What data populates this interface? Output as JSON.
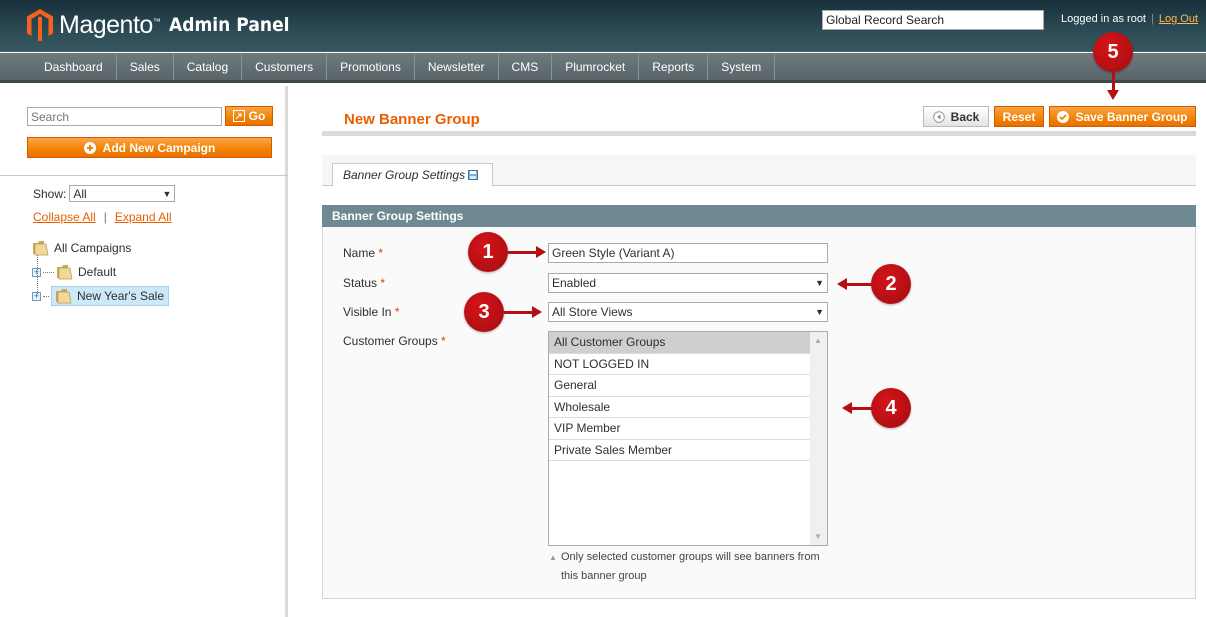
{
  "header": {
    "logo_text": "Magento",
    "logo_tm": "™",
    "logo_sub": "Admin Panel",
    "global_search_value": "Global Record Search",
    "logged_in_text": "Logged in as root",
    "logout_label": "Log Out"
  },
  "nav": {
    "items": [
      "Dashboard",
      "Sales",
      "Catalog",
      "Customers",
      "Promotions",
      "Newsletter",
      "CMS",
      "Plumrocket",
      "Reports",
      "System"
    ]
  },
  "sidebar": {
    "search_placeholder": "Search",
    "go_label": "Go",
    "add_campaign_label": "Add New Campaign",
    "show_label": "Show:",
    "show_value": "All",
    "collapse_all": "Collapse All",
    "expand_all": "Expand All",
    "separator": "|",
    "tree": {
      "root": "All Campaigns",
      "children": [
        "Default",
        "New Year's Sale"
      ],
      "selected": "New Year's Sale"
    }
  },
  "main": {
    "title": "New Banner Group",
    "buttons": {
      "back": "Back",
      "reset": "Reset",
      "save": "Save Banner Group"
    },
    "tab_label": "Banner Group Settings",
    "fieldset_title": "Banner Group Settings",
    "form": {
      "name_label": "Name",
      "name_value": "Green Style (Variant A)",
      "status_label": "Status",
      "status_value": "Enabled",
      "visible_in_label": "Visible In",
      "visible_in_value": "All Store Views",
      "customer_groups_label": "Customer Groups",
      "required_mark": "*",
      "customer_groups": [
        {
          "label": "All Customer Groups",
          "selected": true
        },
        {
          "label": "NOT LOGGED IN",
          "selected": false
        },
        {
          "label": "General",
          "selected": false
        },
        {
          "label": "Wholesale",
          "selected": false
        },
        {
          "label": "VIP Member",
          "selected": false
        },
        {
          "label": "Private Sales Member",
          "selected": false
        }
      ],
      "customer_groups_note": "Only selected customer groups will see banners from this banner group"
    }
  },
  "callouts": [
    "1",
    "2",
    "3",
    "4",
    "5"
  ],
  "colors": {
    "accent_orange": "#eb5e00",
    "callout_red": "#b50f12",
    "fieldset_header": "#6f8992"
  }
}
